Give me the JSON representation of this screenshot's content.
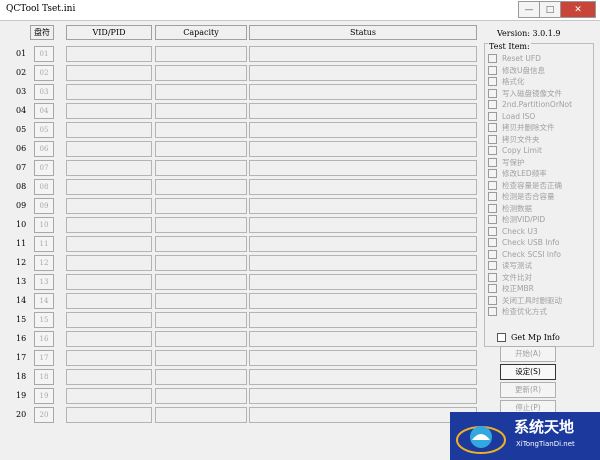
{
  "window": {
    "app_name": "QCTool",
    "ini_name": "Tset.ini",
    "minimize_glyph": "—",
    "maximize_glyph": "□",
    "close_glyph": "✕"
  },
  "columns": {
    "disk": "盘符",
    "vidpid": "VID/PID",
    "capacity": "Capacity",
    "status": "Status"
  },
  "rows": [
    {
      "num": "01",
      "btn": "01"
    },
    {
      "num": "02",
      "btn": "02"
    },
    {
      "num": "03",
      "btn": "03"
    },
    {
      "num": "04",
      "btn": "04"
    },
    {
      "num": "05",
      "btn": "05"
    },
    {
      "num": "06",
      "btn": "06"
    },
    {
      "num": "07",
      "btn": "07"
    },
    {
      "num": "08",
      "btn": "08"
    },
    {
      "num": "09",
      "btn": "09"
    },
    {
      "num": "10",
      "btn": "10"
    },
    {
      "num": "11",
      "btn": "11"
    },
    {
      "num": "12",
      "btn": "12"
    },
    {
      "num": "13",
      "btn": "13"
    },
    {
      "num": "14",
      "btn": "14"
    },
    {
      "num": "15",
      "btn": "15"
    },
    {
      "num": "16",
      "btn": "16"
    },
    {
      "num": "17",
      "btn": "17"
    },
    {
      "num": "18",
      "btn": "18"
    },
    {
      "num": "19",
      "btn": "19"
    },
    {
      "num": "20",
      "btn": "20"
    }
  ],
  "version": "Version: 3.0.1.9",
  "test_panel": {
    "title": "Test Item:",
    "items": [
      "Reset UFD",
      "修改U盘信息",
      "格式化",
      "写入磁盘镜像文件",
      "2nd.PartitionOrNot",
      "Load ISO",
      "拷贝并删除文件",
      "拷贝文件夹",
      "Copy Limit",
      "写保护",
      "修改LED频率",
      "检查容量是否正确",
      "检测是否合容量",
      "检测数据",
      "检测VID/PID",
      "Check U3",
      "Check USB Info",
      "Check SCSI Info",
      "读写测试",
      "文件比对",
      "校正MBR",
      "关闭工具时删驱动",
      "检查优化方式"
    ]
  },
  "get_mp_info": "Get Mp Info",
  "actions": {
    "start": "开始(A)",
    "settings": "设定(S)",
    "update": "更新(R)",
    "stop": "停止(P)"
  },
  "watermark": {
    "title": "系统天地",
    "subtitle": "XiTongTianDi.net"
  }
}
